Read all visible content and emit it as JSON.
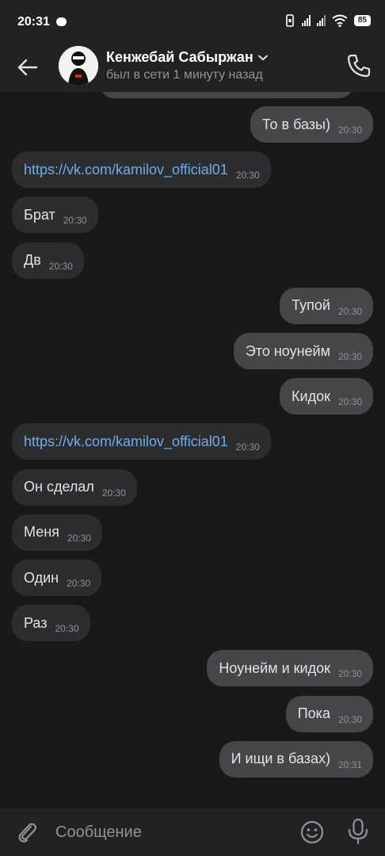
{
  "status_bar": {
    "time": "20:31",
    "battery": "85"
  },
  "header": {
    "name": "Кенжебай Сабыржан",
    "status": "был в сети 1 минуту назад"
  },
  "messages": [
    {
      "text": "То в базы)",
      "time": "20:30",
      "outgoing": true
    },
    {
      "text": "https://vk.com/kamilov_official01",
      "time": "20:30",
      "outgoing": false,
      "link": true
    },
    {
      "text": "Брат",
      "time": "20:30",
      "outgoing": false
    },
    {
      "text": "Дв",
      "time": "20:30",
      "outgoing": false
    },
    {
      "text": "Тупой",
      "time": "20:30",
      "outgoing": true
    },
    {
      "text": "Это ноунейм",
      "time": "20:30",
      "outgoing": true
    },
    {
      "text": "Кидок",
      "time": "20:30",
      "outgoing": true
    },
    {
      "text": "https://vk.com/kamilov_official01",
      "time": "20:30",
      "outgoing": false,
      "link": true
    },
    {
      "text": "Он сделал",
      "time": "20:30",
      "outgoing": false
    },
    {
      "text": "Меня",
      "time": "20:30",
      "outgoing": false
    },
    {
      "text": "Один",
      "time": "20:30",
      "outgoing": false
    },
    {
      "text": "Раз",
      "time": "20:30",
      "outgoing": false
    },
    {
      "text": "Ноунейм и кидок",
      "time": "20:30",
      "outgoing": true
    },
    {
      "text": "Пока",
      "time": "20:30",
      "outgoing": true
    },
    {
      "text": "И ищи в базах)",
      "time": "20:31",
      "outgoing": true
    }
  ],
  "composer": {
    "placeholder": "Сообщение"
  },
  "colors": {
    "background": "#19191a",
    "bar": "#222223",
    "incoming_bubble": "#2c2d2e",
    "outgoing_bubble": "#454647",
    "link": "#71aaeb",
    "secondary_text": "#8e9399"
  }
}
